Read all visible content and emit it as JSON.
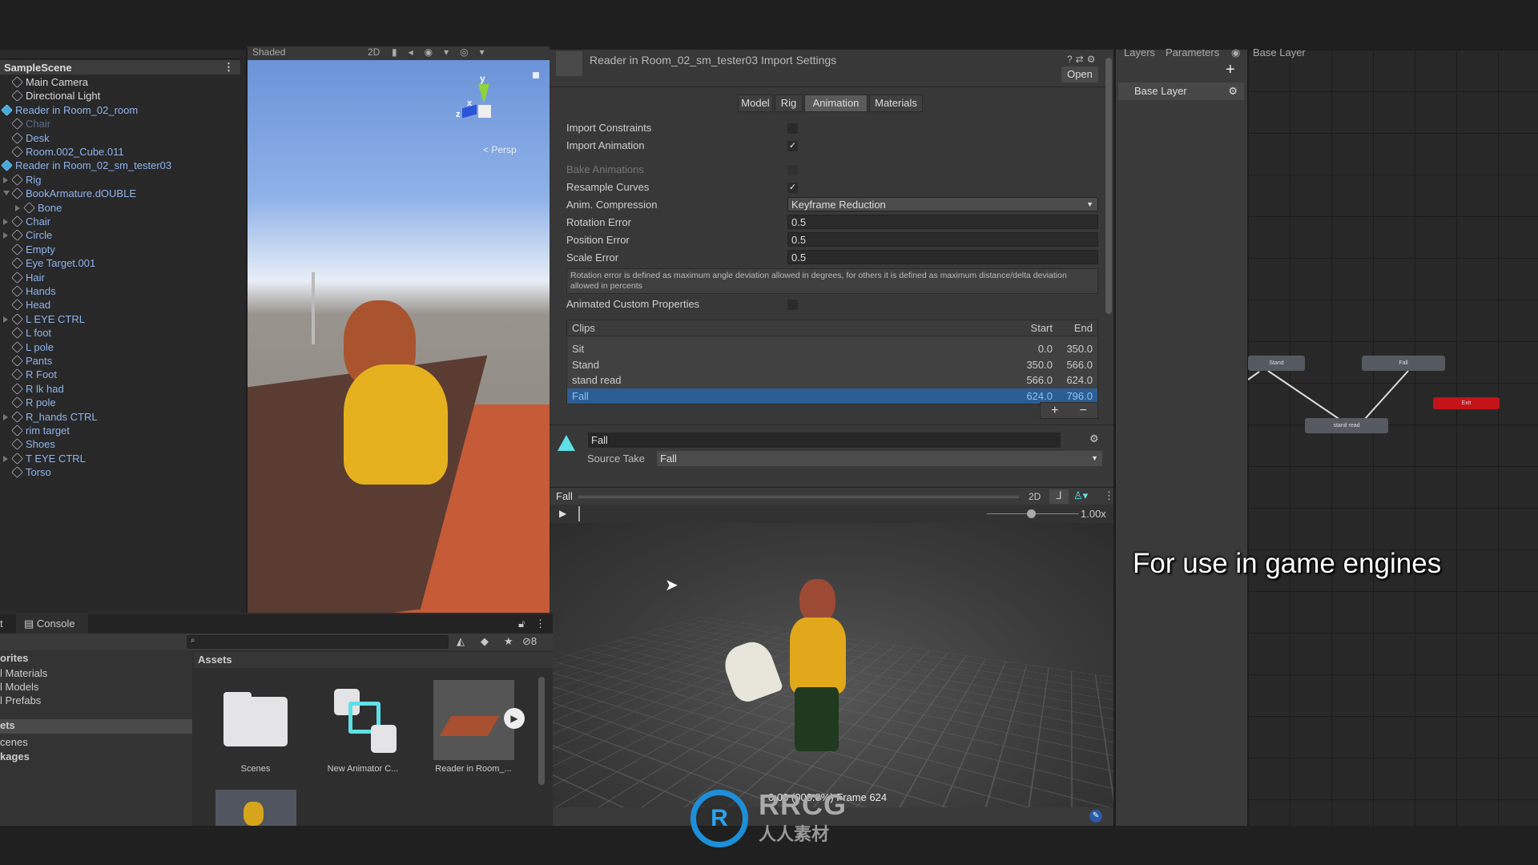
{
  "hierarchy": {
    "scene_name": "SampleScene",
    "items": [
      {
        "label": "Main Camera",
        "style": "white",
        "indent": 0
      },
      {
        "label": "Directional Light",
        "style": "white",
        "indent": 0
      },
      {
        "label": "Reader in Room_02_room",
        "style": "prefab",
        "indent": 0
      },
      {
        "label": "Chair",
        "style": "dim",
        "indent": 1
      },
      {
        "label": "Desk",
        "style": "blue",
        "indent": 1
      },
      {
        "label": "Room.002_Cube.011",
        "style": "blue",
        "indent": 1
      },
      {
        "label": "Reader in Room_02_sm_tester03",
        "style": "prefab",
        "indent": 0
      },
      {
        "label": "Rig",
        "style": "blue",
        "indent": 1,
        "expander": "right"
      },
      {
        "label": "BookArmature.dOUBLE",
        "style": "blue",
        "indent": 1,
        "expander": "down"
      },
      {
        "label": "Bone",
        "style": "blue",
        "indent": 2,
        "expander": "right"
      },
      {
        "label": "Chair",
        "style": "blue",
        "indent": 1,
        "expander": "right"
      },
      {
        "label": "Circle",
        "style": "blue",
        "indent": 1,
        "expander": "right"
      },
      {
        "label": "Empty",
        "style": "blue",
        "indent": 1
      },
      {
        "label": "Eye Target.001",
        "style": "blue",
        "indent": 1
      },
      {
        "label": "Hair",
        "style": "blue",
        "indent": 1
      },
      {
        "label": "Hands",
        "style": "blue",
        "indent": 1
      },
      {
        "label": "Head",
        "style": "blue",
        "indent": 1
      },
      {
        "label": "L EYE CTRL",
        "style": "blue",
        "indent": 1,
        "expander": "right"
      },
      {
        "label": "L foot",
        "style": "blue",
        "indent": 1
      },
      {
        "label": "L pole",
        "style": "blue",
        "indent": 1
      },
      {
        "label": "Pants",
        "style": "blue",
        "indent": 1
      },
      {
        "label": "R Foot",
        "style": "blue",
        "indent": 1
      },
      {
        "label": "R lk had",
        "style": "blue",
        "indent": 1
      },
      {
        "label": "R pole",
        "style": "blue",
        "indent": 1
      },
      {
        "label": "R_hands CTRL",
        "style": "blue",
        "indent": 1,
        "expander": "right"
      },
      {
        "label": "rim target",
        "style": "blue",
        "indent": 1
      },
      {
        "label": "Shoes",
        "style": "blue",
        "indent": 1
      },
      {
        "label": "T EYE CTRL",
        "style": "blue",
        "indent": 1,
        "expander": "right"
      },
      {
        "label": "Torso",
        "style": "blue",
        "indent": 1
      }
    ]
  },
  "scene_view": {
    "shading_mode": "Shaded",
    "mode_2d": "2D",
    "gizmo_label": "Persp",
    "axis_x": "x",
    "axis_y": "y",
    "axis_z": "z"
  },
  "inspector": {
    "title": "Reader in Room_02_sm_tester03 Import Settings",
    "open_label": "Open",
    "tabs": [
      {
        "label": "Model"
      },
      {
        "label": "Rig"
      },
      {
        "label": "Animation",
        "active": true
      },
      {
        "label": "Materials"
      }
    ],
    "import_constraints": {
      "label": "Import Constraints",
      "checked": false
    },
    "import_animation": {
      "label": "Import Animation",
      "checked": true
    },
    "bake_animations": {
      "label": "Bake Animations",
      "checked": false,
      "disabled": true
    },
    "resample_curves": {
      "label": "Resample Curves",
      "checked": true
    },
    "anim_compression": {
      "label": "Anim. Compression",
      "value": "Keyframe Reduction"
    },
    "rotation_error": {
      "label": "Rotation Error",
      "value": "0.5"
    },
    "position_error": {
      "label": "Position Error",
      "value": "0.5"
    },
    "scale_error": {
      "label": "Scale Error",
      "value": "0.5"
    },
    "help_text": "Rotation error is defined as maximum angle deviation allowed in degrees, for others it is defined as maximum distance/delta deviation allowed in percents",
    "animated_custom_properties": {
      "label": "Animated Custom Properties",
      "checked": false
    },
    "clips": {
      "header": "Clips",
      "start_header": "Start",
      "end_header": "End",
      "rows": [
        {
          "name": "Sit",
          "start": "0.0",
          "end": "350.0"
        },
        {
          "name": "Stand",
          "start": "350.0",
          "end": "566.0"
        },
        {
          "name": "stand read",
          "start": "566.0",
          "end": "624.0"
        },
        {
          "name": "Fall",
          "start": "624.0",
          "end": "796.0",
          "selected": true
        }
      ],
      "add_label": "+",
      "remove_label": "−"
    },
    "clip_name": "Fall",
    "source_take": {
      "label": "Source Take",
      "value": "Fall"
    }
  },
  "preview": {
    "clip": "Fall",
    "mode_2d": "2D",
    "speed": "1.00x",
    "speed_value": 1.0,
    "status": "0:00 (000.0%) Frame 624"
  },
  "animator": {
    "tabs": [
      {
        "label": "Layers"
      },
      {
        "label": "Parameters"
      }
    ],
    "breadcrumb": "Base Layer",
    "layer": "Base Layer",
    "add_label": "+",
    "states": [
      {
        "label": "Stand"
      },
      {
        "label": "Fall"
      },
      {
        "label": "stand read"
      },
      {
        "label": "Exit"
      }
    ],
    "exit_color": "#c4141a"
  },
  "project": {
    "tabs": [
      {
        "label": "t"
      },
      {
        "label": "Console"
      }
    ],
    "search_placeholder": "",
    "hidden_count": "8",
    "favorites": [
      "orites",
      "l Materials",
      "l Models",
      "l Prefabs"
    ],
    "folders": [
      {
        "label": "ets",
        "selected": true
      },
      {
        "label": "cenes"
      },
      {
        "label": "kages"
      }
    ],
    "breadcrumb": "Assets",
    "assets": [
      {
        "label": "Scenes"
      },
      {
        "label": "New Animator C..."
      },
      {
        "label": "Reader in Room_..."
      }
    ],
    "accent": "#5fe0e6"
  },
  "overlay": {
    "subtitle": "For use in game engines",
    "watermark": "RRCG 人人素材"
  }
}
